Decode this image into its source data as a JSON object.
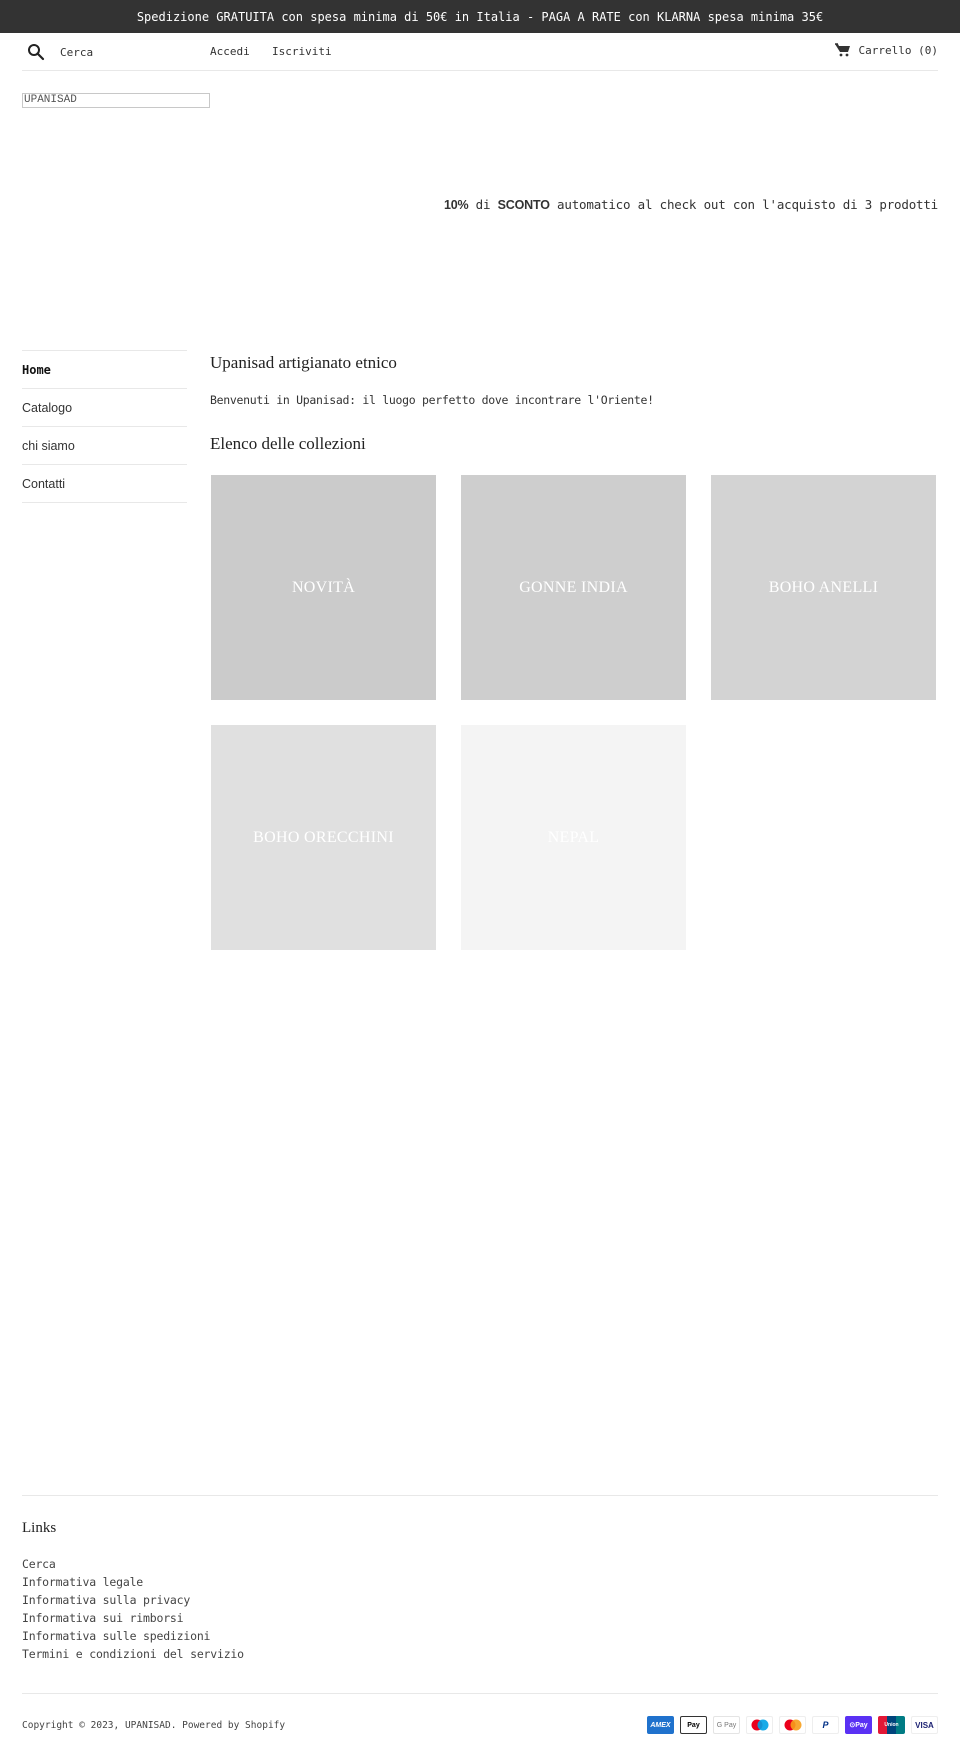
{
  "announcement": "Spedizione GRATUITA con spesa minima di 50€ in Italia - PAGA A RATE con KLARNA spesa minima 35€",
  "header": {
    "search_placeholder": "Cerca",
    "login": "Accedi",
    "register": "Iscriviti",
    "cart": "Carrello (0)"
  },
  "logo": "UPANISAD",
  "promo": {
    "percent": "10%",
    "di": " di ",
    "sconto": "SCONTO",
    "rest": " automatico al check out con l'acquisto di 3 prodotti"
  },
  "sidebar": {
    "items": [
      {
        "label": "Home",
        "active": true
      },
      {
        "label": "Catalogo"
      },
      {
        "label": "chi siamo"
      },
      {
        "label": "Contatti"
      }
    ]
  },
  "main": {
    "title": "Upanisad artigianato etnico",
    "intro": "Benvenuti in Upanisad: il luogo perfetto dove incontrare l'Oriente!",
    "collections_title": "Elenco delle collezioni",
    "collections": [
      {
        "label": "NOVITÀ",
        "color": "#cbcbcb"
      },
      {
        "label": "GONNE INDIA",
        "color": "#cecece"
      },
      {
        "label": "BOHO ANELLI",
        "color": "#d3d3d3"
      },
      {
        "label": "BOHO ORECCHINI",
        "color": "#e0e0e0"
      },
      {
        "label": "NEPAL",
        "color": "#f4f4f4"
      }
    ]
  },
  "footer": {
    "links_title": "Links",
    "links": [
      "Cerca",
      "Informativa legale",
      "Informativa sulla privacy",
      "Informativa sui rimborsi",
      "Informativa sulle spedizioni",
      "Termini e condizioni del servizio"
    ],
    "copyright": "Copyright © 2023, UPANISAD. Powered by Shopify",
    "payments": [
      {
        "name": "American Express",
        "label": "AMEX"
      },
      {
        "name": "Apple Pay",
        "label": " Pay"
      },
      {
        "name": "Google Pay",
        "label": "G Pay"
      },
      {
        "name": "Maestro",
        "label": ""
      },
      {
        "name": "Mastercard",
        "label": ""
      },
      {
        "name": "PayPal",
        "label": "P"
      },
      {
        "name": "Shop Pay",
        "label": "⊙Pay"
      },
      {
        "name": "UnionPay",
        "label": "Union"
      },
      {
        "name": "Visa",
        "label": "VISA"
      }
    ]
  }
}
